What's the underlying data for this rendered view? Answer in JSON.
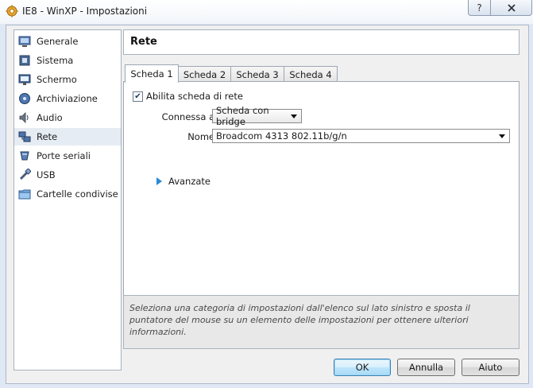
{
  "window": {
    "title": "IE8 - WinXP - Impostazioni",
    "help_label": "?",
    "close_label": "x"
  },
  "sidebar": {
    "items": [
      {
        "label": "Generale",
        "icon": "monitor-icon"
      },
      {
        "label": "Sistema",
        "icon": "chip-icon"
      },
      {
        "label": "Schermo",
        "icon": "display-icon"
      },
      {
        "label": "Archiviazione",
        "icon": "disk-icon"
      },
      {
        "label": "Audio",
        "icon": "speaker-icon"
      },
      {
        "label": "Rete",
        "icon": "network-icon",
        "selected": true
      },
      {
        "label": "Porte seriali",
        "icon": "serial-port-icon"
      },
      {
        "label": "USB",
        "icon": "usb-icon"
      },
      {
        "label": "Cartelle condivise",
        "icon": "folder-icon"
      }
    ]
  },
  "page": {
    "title": "Rete"
  },
  "tabs": [
    "Scheda 1",
    "Scheda 2",
    "Scheda 3",
    "Scheda 4"
  ],
  "adapter": {
    "enable_label": "Abilita scheda di rete",
    "enabled": true,
    "attached_label": "Connessa a:",
    "attached_value": "Scheda con bridge",
    "name_label": "Nome:",
    "name_value": "Broadcom 4313 802.11b/g/n",
    "advanced_label": "Avanzate"
  },
  "info": {
    "text": "Seleziona una categoria di impostazioni dall'elenco sul lato sinistro e sposta il puntatore del mouse su un elemento delle impostazioni per ottenere ulteriori informazioni."
  },
  "buttons": {
    "ok": "OK",
    "cancel": "Annulla",
    "help": "Aiuto"
  },
  "colors": {
    "accent": "#2a8ad6",
    "selected_row": "#e6ecf3"
  }
}
